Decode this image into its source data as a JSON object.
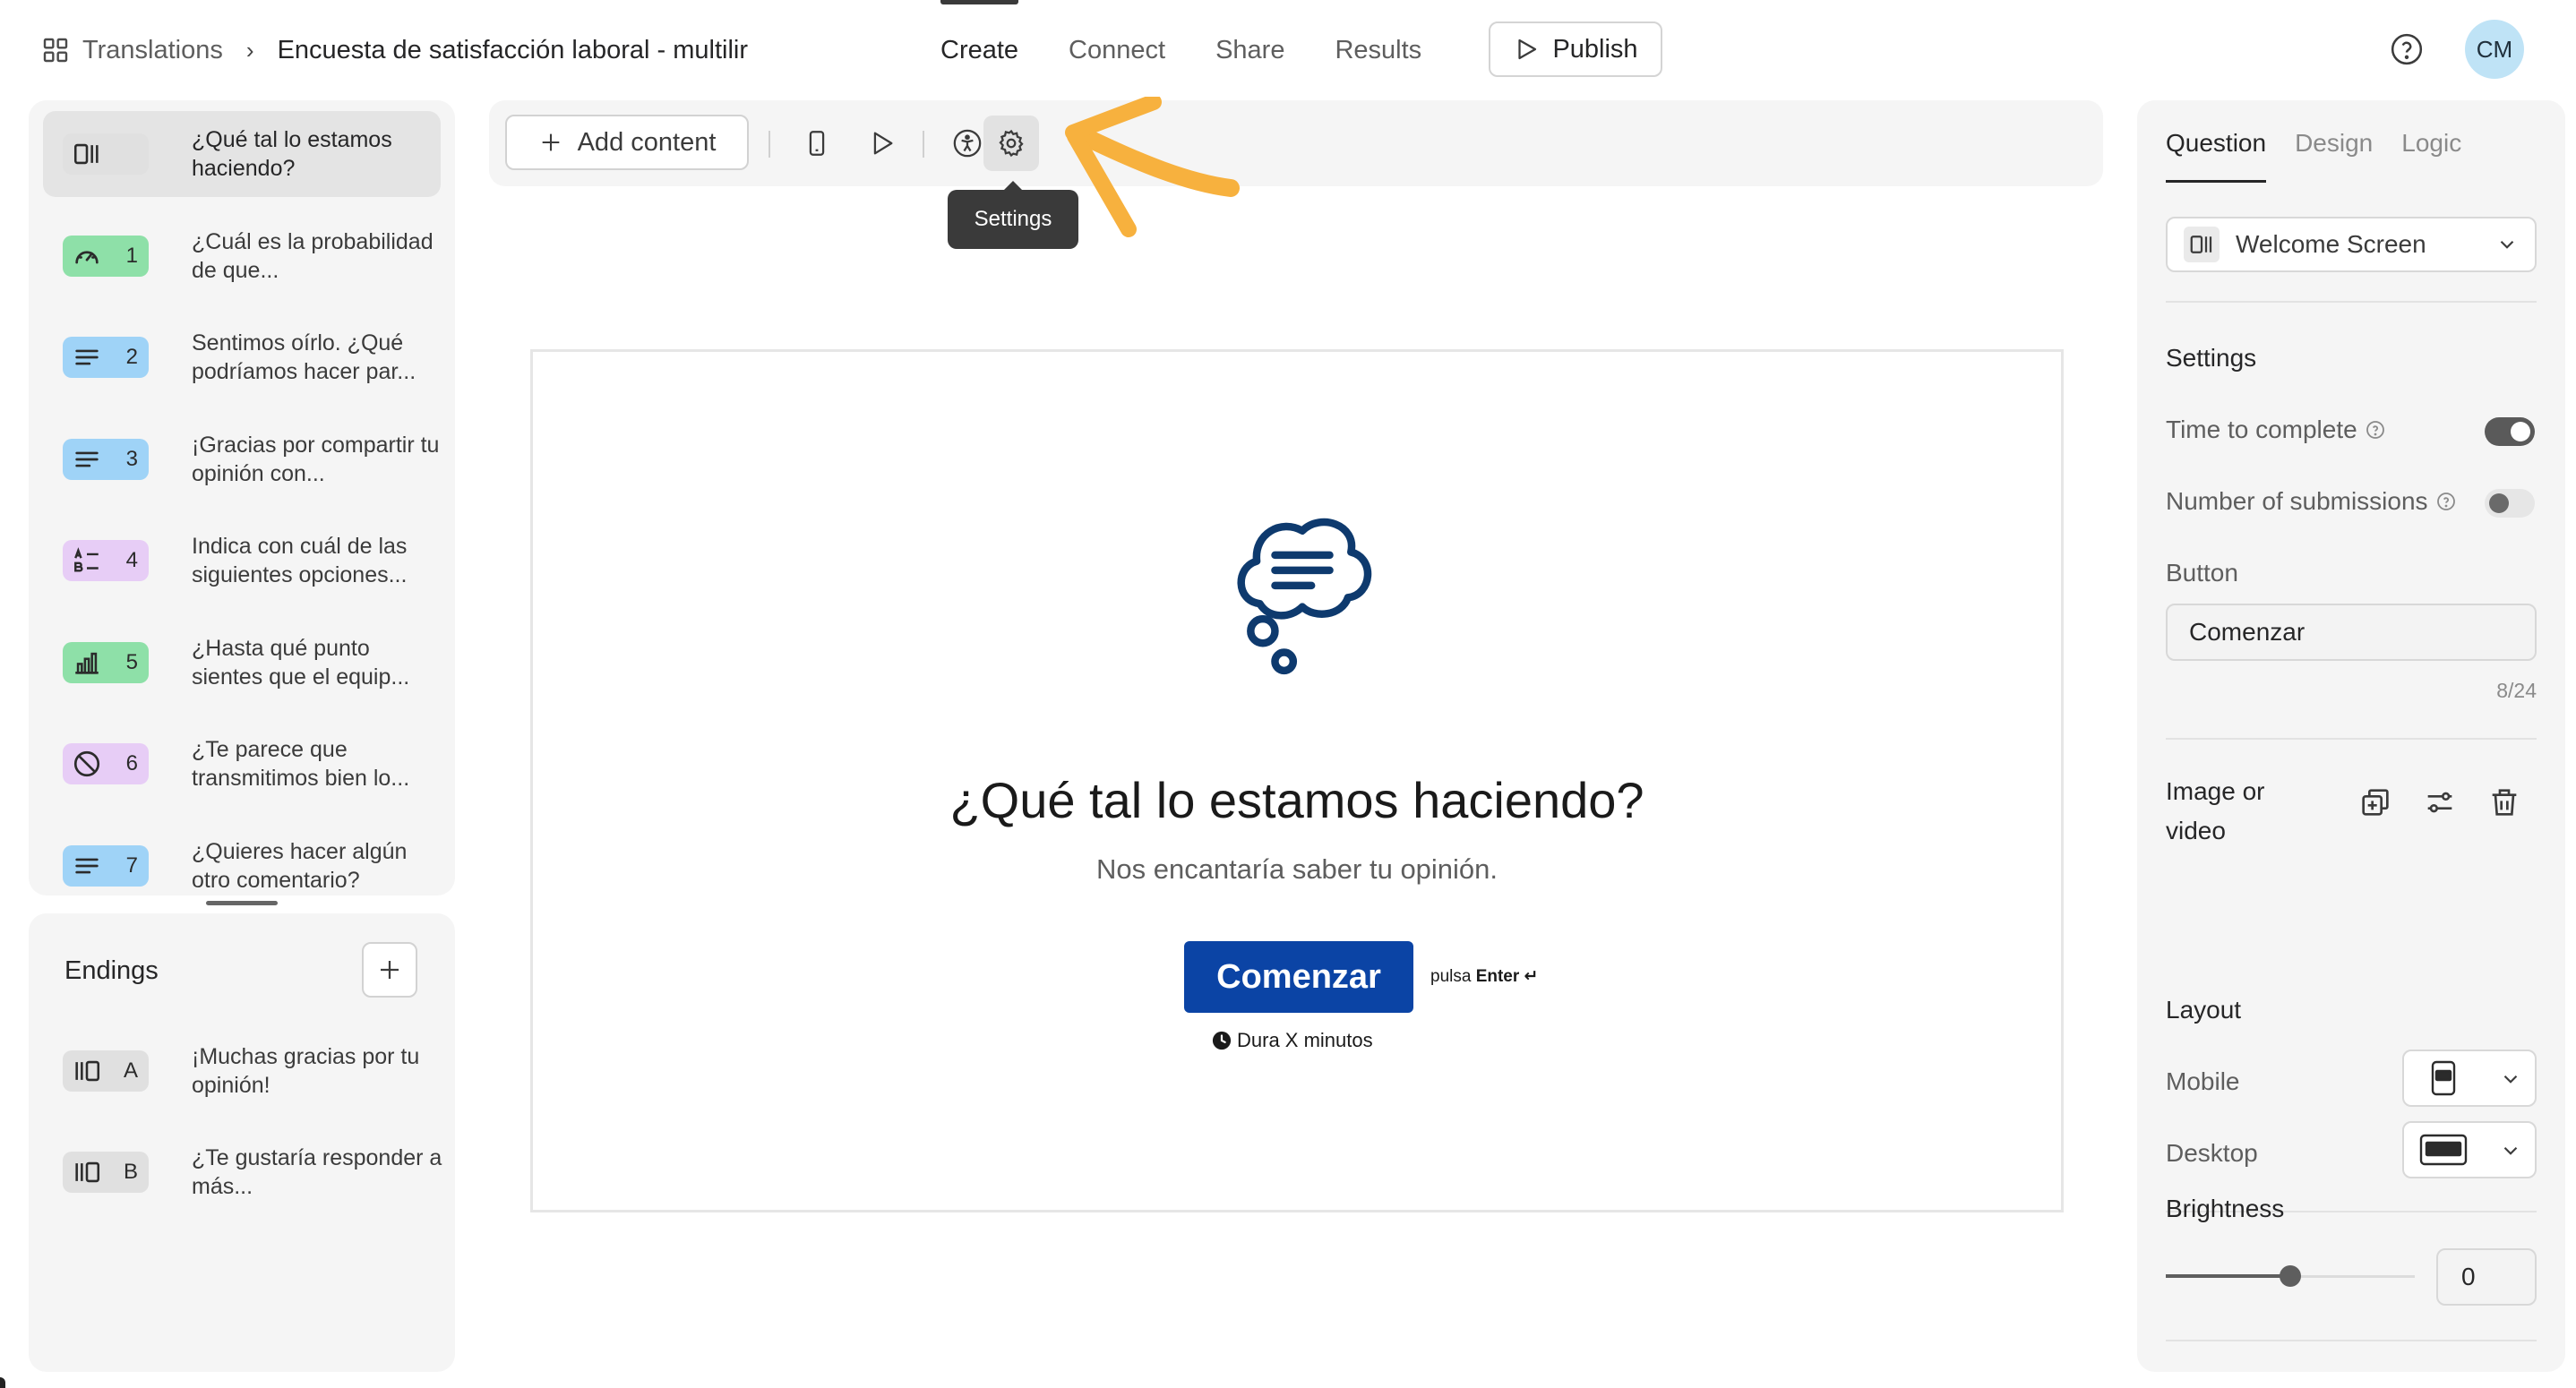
{
  "breadcrumb": {
    "root": "Translations",
    "separator": "›",
    "title": "Encuesta de satisfacción laboral - multilir"
  },
  "nav": {
    "tabs": [
      {
        "label": "Create",
        "active": true
      },
      {
        "label": "Connect",
        "active": false
      },
      {
        "label": "Share",
        "active": false
      },
      {
        "label": "Results",
        "active": false
      }
    ],
    "publish_label": "Publish"
  },
  "user": {
    "initials": "CM"
  },
  "questions": [
    {
      "num": "",
      "text": "¿Qué tal lo estamos haciendo?",
      "icon": "welcome-screen-icon",
      "badge_color": "#e0e0e0",
      "selected": true
    },
    {
      "num": "1",
      "text": "¿Cuál es la probabilidad de que...",
      "icon": "gauge-icon",
      "badge_color": "#8ee0a8",
      "selected": false
    },
    {
      "num": "2",
      "text": "Sentimos oírlo. ¿Qué podríamos hacer par...",
      "icon": "long-text-icon",
      "badge_color": "#9fd3f7",
      "selected": false
    },
    {
      "num": "3",
      "text": "¡Gracias por compartir tu opinión con...",
      "icon": "long-text-icon",
      "badge_color": "#9fd3f7",
      "selected": false
    },
    {
      "num": "4",
      "text": "Indica con cuál de las siguientes opciones...",
      "icon": "multiple-choice-icon",
      "badge_color": "#e7cdf6",
      "selected": false
    },
    {
      "num": "5",
      "text": "¿Hasta qué punto sientes que el equip...",
      "icon": "rating-bars-icon",
      "badge_color": "#8ee0a8",
      "selected": false
    },
    {
      "num": "6",
      "text": "¿Te parece que transmitimos bien lo...",
      "icon": "prohibited-icon",
      "badge_color": "#e7cdf6",
      "selected": false
    },
    {
      "num": "7",
      "text": "¿Quieres hacer algún otro comentario?",
      "icon": "long-text-icon",
      "badge_color": "#9fd3f7",
      "selected": false
    }
  ],
  "endings": {
    "title": "Endings",
    "items": [
      {
        "letter": "A",
        "text": "¡Muchas gracias por tu opinión!",
        "icon": "ending-screen-icon"
      },
      {
        "letter": "B",
        "text": "¿Te gustaría responder a más...",
        "icon": "ending-screen-icon"
      }
    ]
  },
  "toolbar": {
    "add_content_label": "Add content",
    "tooltip": "Settings"
  },
  "preview": {
    "title": "¿Qué tal lo estamos haciendo?",
    "subtitle": "Nos encantaría saber tu opinión.",
    "button_label": "Comenzar",
    "press_hint_prefix": "pulsa",
    "press_hint_key": "Enter ↵",
    "duration": "Dura X minutos",
    "accent_color": "#0b44a5"
  },
  "panel": {
    "tabs": [
      {
        "label": "Question",
        "active": true
      },
      {
        "label": "Design",
        "active": false
      },
      {
        "label": "Logic",
        "active": false
      }
    ],
    "question_type": "Welcome Screen",
    "settings_heading": "Settings",
    "time_to_complete_label": "Time to complete",
    "time_to_complete_on": true,
    "submissions_label": "Number of submissions",
    "submissions_on": false,
    "button_heading": "Button",
    "button_value": "Comenzar",
    "button_counter": "8/24",
    "image_video_label": "Image or video",
    "layout_heading": "Layout",
    "mobile_label": "Mobile",
    "desktop_label": "Desktop",
    "brightness_heading": "Brightness",
    "brightness_value": "0",
    "brightness_fraction": 0.5
  }
}
